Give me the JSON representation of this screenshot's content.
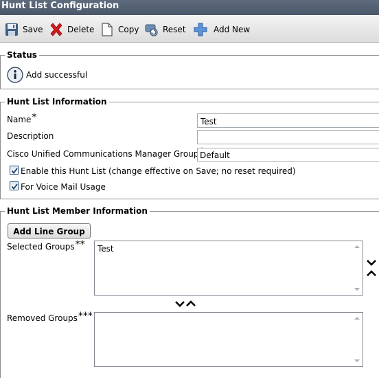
{
  "window": {
    "title": "Hunt List Configuration"
  },
  "toolbar": {
    "save": "Save",
    "delete": "Delete",
    "copy": "Copy",
    "reset": "Reset",
    "add_new": "Add New"
  },
  "status": {
    "legend": "Status",
    "message": "Add successful",
    "icon": "info-icon"
  },
  "info": {
    "legend": "Hunt List Information",
    "name_label": "Name",
    "name_value": "Test",
    "description_label": "Description",
    "description_value": "",
    "cucm_group_label": "Cisco Unified Communications Manager Group",
    "cucm_group_value": "Default",
    "enable_label": "Enable this Hunt List (change effective on Save; no reset required)",
    "enable_checked": true,
    "voicemail_label": "For Voice Mail Usage",
    "voicemail_checked": true,
    "required_mark": "*"
  },
  "members": {
    "legend": "Hunt List Member Information",
    "add_button": "Add Line Group",
    "selected_label": "Selected Groups",
    "selected_mark": "**",
    "selected_items": [
      "Test"
    ],
    "removed_label": "Removed Groups",
    "removed_mark": "***",
    "removed_items": []
  },
  "colors": {
    "title_bar": "#4f5b6e",
    "toolbar": "#e6e6e6",
    "delete_icon": "#d11a1a",
    "add_icon": "#3a78c8"
  }
}
